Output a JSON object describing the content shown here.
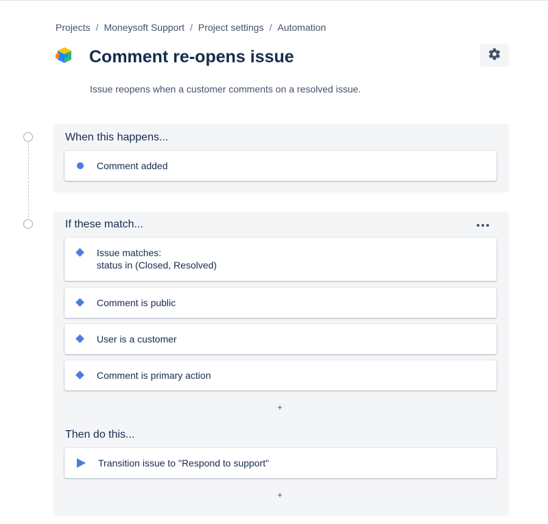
{
  "breadcrumb": {
    "items": [
      "Projects",
      "Moneysoft Support",
      "Project settings",
      "Automation"
    ],
    "separator": "/"
  },
  "rule": {
    "title": "Comment re-opens issue",
    "description": "Issue reopens when a customer comments on a resolved issue.",
    "icon": "rule-cube-icon"
  },
  "settings": {
    "icon": "gear-icon"
  },
  "trigger": {
    "heading": "When this happens...",
    "items": [
      {
        "label": "Comment added",
        "icon": "trigger-dot-icon"
      }
    ]
  },
  "conditions": {
    "heading": "If these match...",
    "more_label": "•••",
    "items": [
      {
        "line1": "Issue matches:",
        "line2": "status in (Closed, Resolved)",
        "icon": "condition-diamond-icon"
      },
      {
        "line1": "Comment is public",
        "icon": "condition-diamond-icon"
      },
      {
        "line1": "User is a customer",
        "icon": "condition-diamond-icon"
      },
      {
        "line1": "Comment is primary action",
        "icon": "condition-diamond-icon"
      }
    ],
    "add_label": "+"
  },
  "actions": {
    "heading": "Then do this...",
    "items": [
      {
        "label": "Transition issue to \"Respond to support\"",
        "icon": "action-play-icon"
      }
    ],
    "add_label": "+"
  },
  "colors": {
    "accent": "#4c7cdf",
    "panel_bg": "#f4f5f7",
    "text": "#172b4d",
    "subtle_text": "#42526e"
  }
}
